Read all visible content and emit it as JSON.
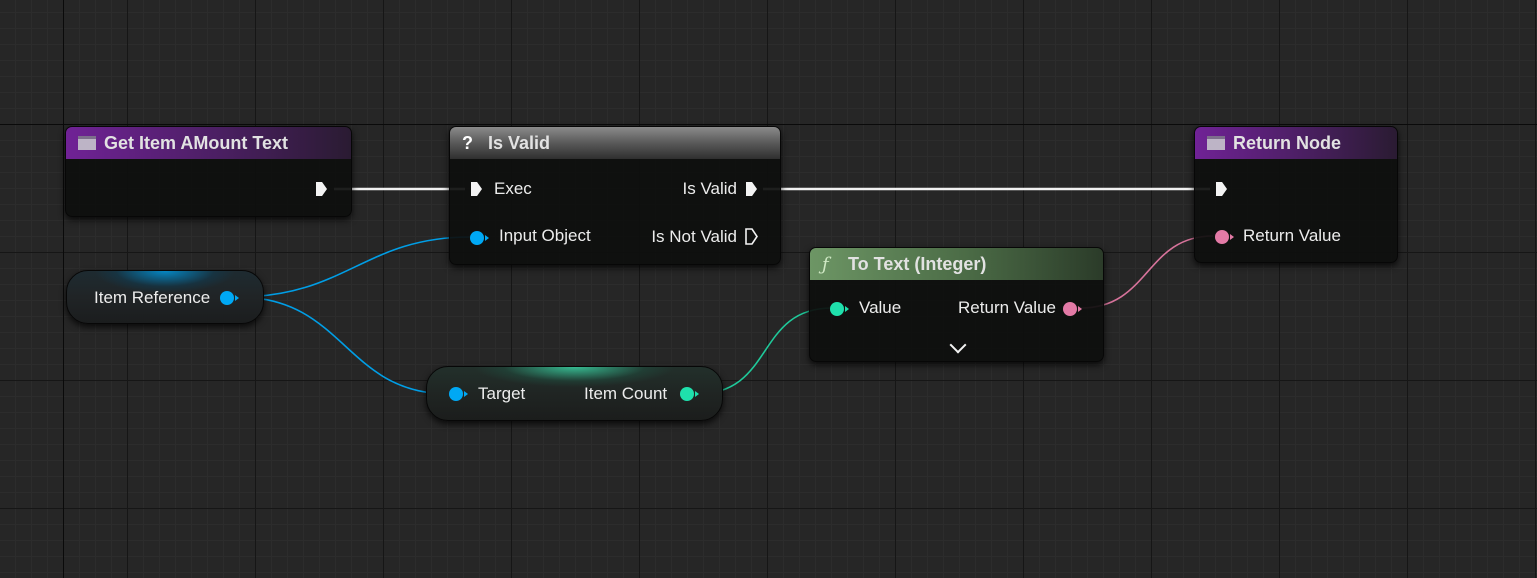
{
  "colors": {
    "canvas": "#262626",
    "exec_wire": "#ffffff",
    "object_pin": "#00a8f4",
    "integer_pin": "#1fe0ac",
    "text_pin": "#e37aa6",
    "function_header": "#702296",
    "macro_header": "#8b8b8b",
    "pure_function_header": "#6d9665"
  },
  "nodes": {
    "entry": {
      "title": "Get Item AMount Text",
      "icon": "function-icon"
    },
    "is_valid": {
      "title": "Is Valid",
      "icon": "question-mark-icon",
      "inputs": [
        "Exec",
        "Input Object"
      ],
      "outputs": [
        "Is Valid",
        "Is Not Valid"
      ]
    },
    "return": {
      "title": "Return Node",
      "icon": "function-icon",
      "inputs": [
        "Return Value"
      ]
    },
    "to_text": {
      "title": "To Text (Integer)",
      "icon": "f-function-icon",
      "inputs": [
        "Value"
      ],
      "outputs": [
        "Return Value"
      ],
      "expand_icon": "chevron-down-icon"
    },
    "item_reference": {
      "label": "Item Reference"
    },
    "get_item_count": {
      "input": "Target",
      "output": "Item Count"
    }
  }
}
